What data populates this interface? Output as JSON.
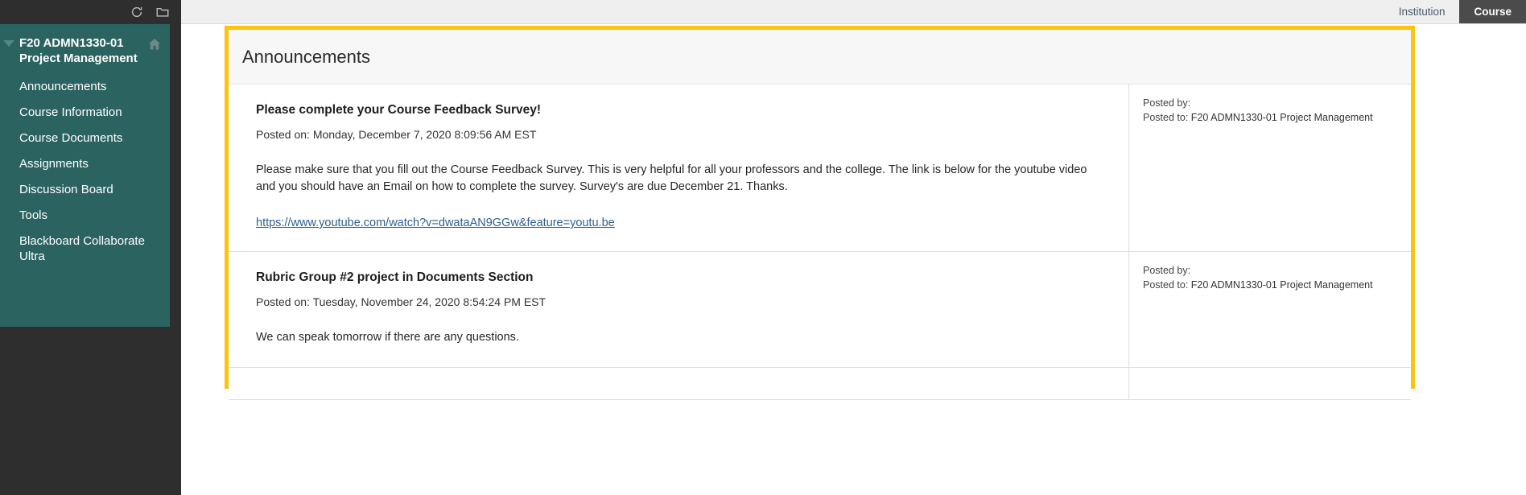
{
  "topbar": {
    "icons": [
      {
        "name": "refresh-icon",
        "label": "Refresh"
      },
      {
        "name": "folder-icon",
        "label": "Folder"
      }
    ]
  },
  "sidebar": {
    "course_title": "F20 ADMN1330-01 Project Management",
    "home_icon": "home-icon",
    "collapse_icon": "caret-down-icon",
    "items": [
      {
        "label": "Announcements"
      },
      {
        "label": "Course Information"
      },
      {
        "label": "Course Documents"
      },
      {
        "label": "Assignments"
      },
      {
        "label": "Discussion Board"
      },
      {
        "label": "Tools"
      },
      {
        "label": "Blackboard Collaborate Ultra"
      }
    ]
  },
  "tabs": [
    {
      "label": "Institution",
      "active": false
    },
    {
      "label": "Course",
      "active": true
    }
  ],
  "page": {
    "heading": "Announcements",
    "highlight_color": "#fcc310"
  },
  "announcements": [
    {
      "title": "Please complete your Course Feedback Survey!",
      "posted_on": "Posted on: Monday, December 7, 2020 8:09:56 AM EST",
      "body": "Please make sure that you fill out the Course Feedback Survey. This is very helpful for all your professors and the college. The link is below for the youtube video and you should have an Email on how to complete the survey. Survey's are due December 21. Thanks.",
      "link": "https://www.youtube.com/watch?v=dwataAN9GGw&feature=youtu.be",
      "posted_by_label": "Posted by:",
      "posted_by_value": "",
      "posted_to_label": "Posted to:",
      "posted_to_value": "F20 ADMN1330-01 Project Management"
    },
    {
      "title": "Rubric Group #2 project in Documents Section",
      "posted_on": "Posted on: Tuesday, November 24, 2020 8:54:24 PM EST",
      "body": "We can speak tomorrow if there are any questions.",
      "link": "",
      "posted_by_label": "Posted by:",
      "posted_by_value": "",
      "posted_to_label": "Posted to:",
      "posted_to_value": "F20 ADMN1330-01 Project Management"
    }
  ]
}
